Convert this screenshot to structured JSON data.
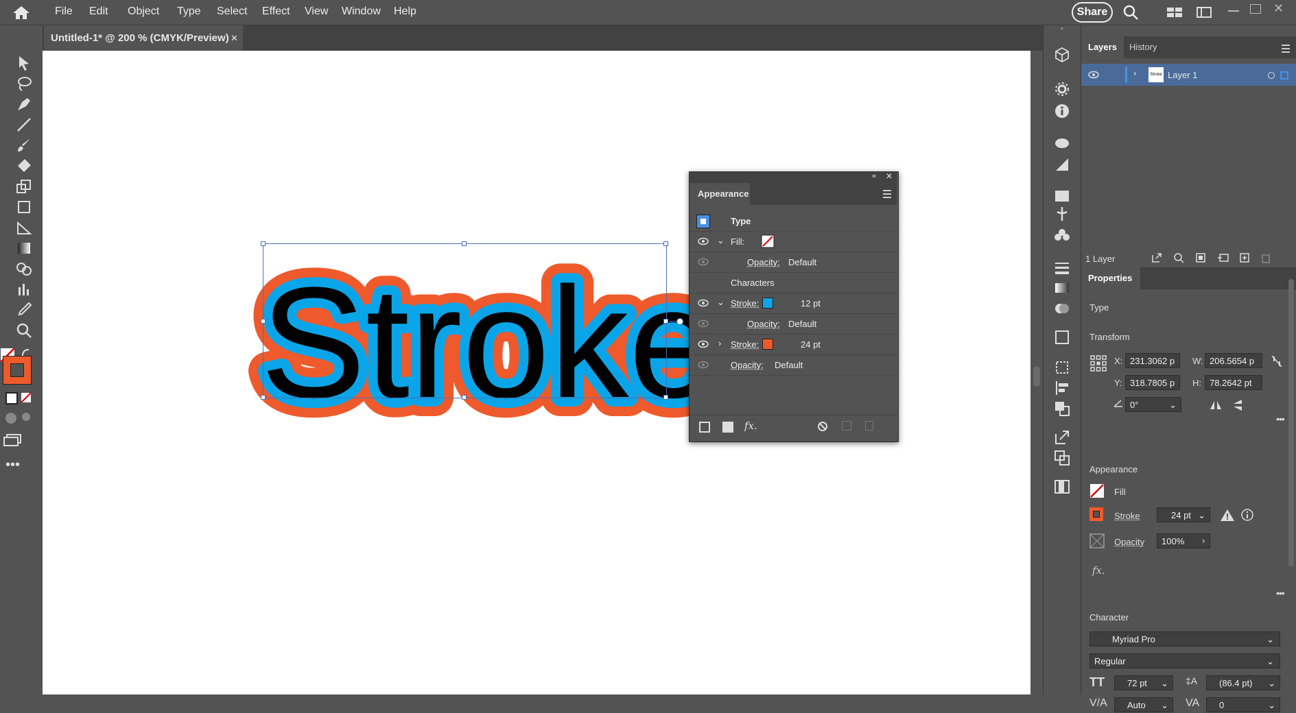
{
  "menu": [
    "File",
    "Edit",
    "Object",
    "Type",
    "Select",
    "Effect",
    "View",
    "Window",
    "Help"
  ],
  "share_label": "Share",
  "document_tab": {
    "title": "Untitled-1* @ 200 % (CMYK/Preview)",
    "close": "✕"
  },
  "artwork": {
    "text": "Stroke",
    "fill_color": "#000000",
    "inner_stroke_color": "#0aa5e8",
    "outer_stroke_color": "#ef5a2c"
  },
  "appearance_panel": {
    "title": "Appearance",
    "rows": [
      {
        "label": "Type"
      },
      {
        "label": "Fill:"
      },
      {
        "label": "Opacity:",
        "value": "Default"
      },
      {
        "label": "Characters"
      },
      {
        "label": "Stroke:",
        "value": "12 pt",
        "color": "#0aa5e8"
      },
      {
        "label": "Opacity:",
        "value": "Default"
      },
      {
        "label": "Stroke:",
        "value": "24 pt",
        "color": "#ef5a2c"
      },
      {
        "label": "Opacity:",
        "value": "Default"
      }
    ],
    "footer_fx": "fx."
  },
  "layers_panel": {
    "tabs": [
      "Layers",
      "History"
    ],
    "layer_name": "Layer 1",
    "thumb_text": "Stroke",
    "count": "1 Layer"
  },
  "properties_panel": {
    "tab": "Properties",
    "type_label": "Type",
    "transform": {
      "label": "Transform",
      "x_label": "X:",
      "x": "231.3062 p",
      "y_label": "Y:",
      "y": "318.7805 p",
      "w_label": "W:",
      "w": "206.5654 p",
      "h_label": "H:",
      "h": "78.2642 pt",
      "angle": "0°"
    },
    "appearance": {
      "label": "Appearance",
      "fill_label": "Fill",
      "stroke_label": "Stroke",
      "stroke_value": "24 pt",
      "opacity_label": "Opacity",
      "opacity_value": "100%",
      "fx": "fx."
    },
    "character": {
      "label": "Character",
      "font": "Myriad Pro",
      "style": "Regular",
      "size": "72 pt",
      "leading": "(86.4 pt)",
      "kerning": "Auto",
      "tracking": "0"
    }
  },
  "colors": {
    "accent": "#4a90e2",
    "orange": "#ef5a2c",
    "cyan": "#0aa5e8"
  }
}
